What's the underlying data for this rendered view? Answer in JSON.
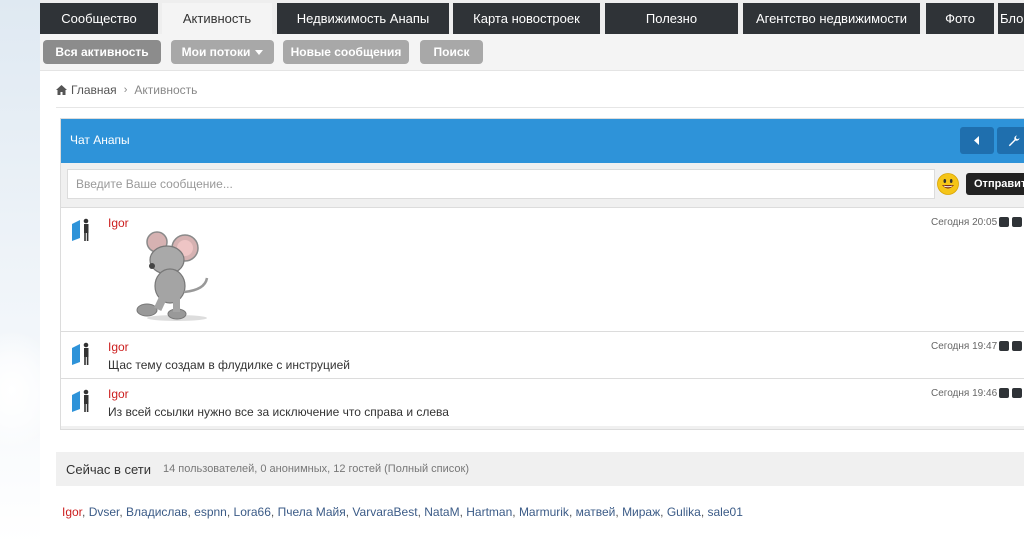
{
  "nav": {
    "tabs": [
      "Сообщество",
      "Активность",
      "Недвижимость Анапы",
      "Карта новостроек",
      "Полезно",
      "Агентство недвижимости",
      "Фото",
      "Блоги"
    ],
    "active": "Активность"
  },
  "subnav": {
    "all_activity": "Вся активность",
    "my_streams": "Мои потоки",
    "new_messages": "Новые сообщения",
    "search": "Поиск"
  },
  "breadcrumb": {
    "home": "Главная",
    "current": "Активность"
  },
  "chat": {
    "title": "Чат Анапы",
    "input_placeholder": "Введите Ваше сообщение...",
    "send_label": "Отправить",
    "messages": [
      {
        "author": "Igor",
        "time": "Сегодня 20:05",
        "text": ""
      },
      {
        "author": "Igor",
        "time": "Сегодня 19:47",
        "text": "Щас тему создам в флудилке с инструцией"
      },
      {
        "author": "Igor",
        "time": "Сегодня 19:46",
        "text": "Из всей ссылки нужно все за исключение что справа и слева"
      }
    ]
  },
  "online": {
    "title": "Сейчас в сети",
    "stats": "14 пользователей, 0 анонимных, 12 гостей (Полный список)",
    "users": [
      "Igor",
      "Dvser",
      "Владислав",
      "espnn",
      "Lora66",
      "Пчела Майя",
      "VarvaraBest",
      "NataM",
      "Hartman",
      "Marmurik",
      "матвей",
      "Мираж",
      "Gulika",
      "sale01"
    ]
  },
  "colors": {
    "header_blue": "#2e93d9",
    "nav_dark": "#2f3337",
    "author_red": "#cc1f1f",
    "link_blue": "#3b5b87"
  }
}
